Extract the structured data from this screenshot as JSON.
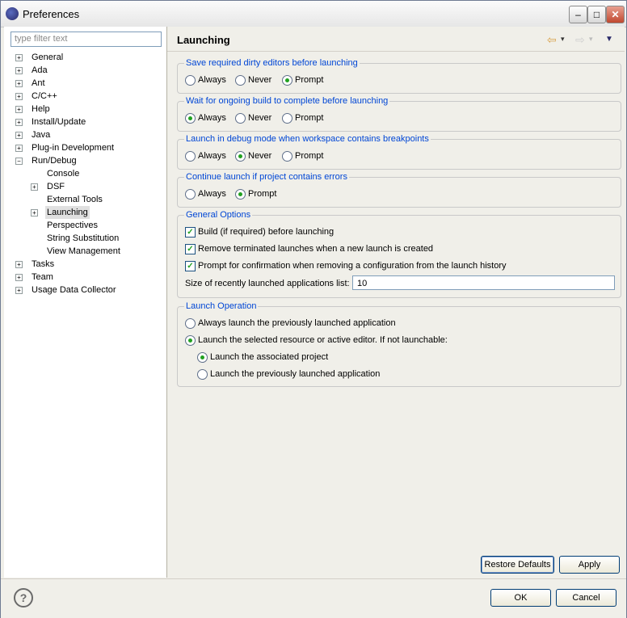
{
  "window": {
    "title": "Preferences",
    "min": "–",
    "max": "□",
    "close": "✕"
  },
  "filter": {
    "placeholder": "type filter text"
  },
  "tree": [
    {
      "label": "General",
      "level": 0,
      "expander": "+"
    },
    {
      "label": "Ada",
      "level": 0,
      "expander": "+"
    },
    {
      "label": "Ant",
      "level": 0,
      "expander": "+"
    },
    {
      "label": "C/C++",
      "level": 0,
      "expander": "+"
    },
    {
      "label": "Help",
      "level": 0,
      "expander": "+"
    },
    {
      "label": "Install/Update",
      "level": 0,
      "expander": "+"
    },
    {
      "label": "Java",
      "level": 0,
      "expander": "+"
    },
    {
      "label": "Plug-in Development",
      "level": 0,
      "expander": "+"
    },
    {
      "label": "Run/Debug",
      "level": 0,
      "expander": "−"
    },
    {
      "label": "Console",
      "level": 1,
      "expander": ""
    },
    {
      "label": "DSF",
      "level": 1,
      "expander": "+"
    },
    {
      "label": "External Tools",
      "level": 1,
      "expander": ""
    },
    {
      "label": "Launching",
      "level": 1,
      "expander": "+",
      "selected": true
    },
    {
      "label": "Perspectives",
      "level": 1,
      "expander": ""
    },
    {
      "label": "String Substitution",
      "level": 1,
      "expander": ""
    },
    {
      "label": "View Management",
      "level": 1,
      "expander": ""
    },
    {
      "label": "Tasks",
      "level": 0,
      "expander": "+"
    },
    {
      "label": "Team",
      "level": 0,
      "expander": "+"
    },
    {
      "label": "Usage Data Collector",
      "level": 0,
      "expander": "+"
    }
  ],
  "page": {
    "title": "Launching",
    "back_arrow": "⇦",
    "forward_arrow": "⇨",
    "dropdown": "▾",
    "menu": "▼"
  },
  "groups": {
    "save_dirty": {
      "title": "Save required dirty editors before launching",
      "options": [
        "Always",
        "Never",
        "Prompt"
      ],
      "selected": "Prompt"
    },
    "wait_build": {
      "title": "Wait for ongoing build to complete before launching",
      "options": [
        "Always",
        "Never",
        "Prompt"
      ],
      "selected": "Always"
    },
    "debug_mode": {
      "title": "Launch in debug mode when workspace contains breakpoints",
      "options": [
        "Always",
        "Never",
        "Prompt"
      ],
      "selected": "Never"
    },
    "continue_errors": {
      "title": "Continue launch if project contains errors",
      "options": [
        "Always",
        "Prompt"
      ],
      "selected": "Prompt"
    },
    "general": {
      "title": "General Options",
      "build_label": "Build (if required) before launching",
      "remove_label": "Remove terminated launches when a new launch is created",
      "prompt_label": "Prompt for confirmation when removing a configuration from the launch history",
      "size_label": "Size of recently launched applications list:",
      "size_value": "10",
      "checked": "✓"
    },
    "operation": {
      "title": "Launch Operation",
      "always_label": "Always launch the previously launched application",
      "selected_label": "Launch the selected resource or active editor. If not launchable:",
      "associated_label": "Launch the associated project",
      "previous_label": "Launch the previously launched application"
    }
  },
  "buttons": {
    "restore": "Restore Defaults",
    "apply": "Apply",
    "ok": "OK",
    "cancel": "Cancel",
    "help": "?"
  }
}
